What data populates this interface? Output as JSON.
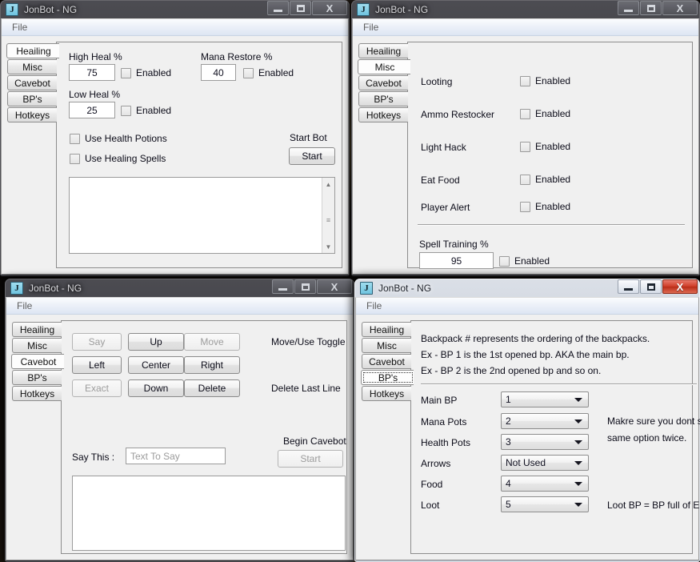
{
  "app": {
    "title": "JonBot - NG",
    "icon": "J"
  },
  "menu": {
    "file": "File"
  },
  "window_buttons": {
    "minimize": "minimize-icon",
    "maximize": "maximize-icon",
    "close": "X"
  },
  "tabs": [
    "Heailing",
    "Misc",
    "Cavebot",
    "BP's",
    "Hotkeys"
  ],
  "windows": {
    "healing": {
      "active_tab": "Heailing",
      "high_heal_label": "High Heal %",
      "high_heal_value": "75",
      "high_heal_enabled_label": "Enabled",
      "low_heal_label": "Low Heal %",
      "low_heal_value": "25",
      "low_heal_enabled_label": "Enabled",
      "mana_restore_label": "Mana Restore %",
      "mana_restore_value": "40",
      "mana_restore_enabled_label": "Enabled",
      "use_health_potions": "Use Health Potions",
      "use_healing_spells": "Use Healing Spells",
      "start_bot_label": "Start Bot",
      "start_button": "Start"
    },
    "misc": {
      "active_tab": "Misc",
      "rows": [
        {
          "label": "Looting",
          "enabled_label": "Enabled"
        },
        {
          "label": "Ammo Restocker",
          "enabled_label": "Enabled"
        },
        {
          "label": "Light Hack",
          "enabled_label": "Enabled"
        },
        {
          "label": "Eat Food",
          "enabled_label": "Enabled"
        },
        {
          "label": "Player Alert",
          "enabled_label": "Enabled"
        }
      ],
      "spell_training_label": "Spell Training %",
      "spell_training_value": "95",
      "spell_training_enabled_label": "Enabled"
    },
    "cavebot": {
      "active_tab": "Cavebot",
      "buttons": [
        {
          "label": "Say",
          "disabled": true
        },
        {
          "label": "Up",
          "disabled": false
        },
        {
          "label": "Move",
          "disabled": true
        },
        {
          "label": "Left",
          "disabled": false
        },
        {
          "label": "Center",
          "disabled": false
        },
        {
          "label": "Right",
          "disabled": false
        },
        {
          "label": "Exact",
          "disabled": true
        },
        {
          "label": "Down",
          "disabled": false
        },
        {
          "label": "Delete",
          "disabled": false
        }
      ],
      "move_use_toggle": "Move/Use Toggle",
      "delete_last_line": "Delete Last Line",
      "begin_cavebot": "Begin Cavebot",
      "start_button": "Start",
      "say_this_label": "Say This :",
      "say_this_placeholder": "Text To Say"
    },
    "bps": {
      "active_tab": "BP's",
      "info_lines": [
        "Backpack # represents the ordering of the backpacks.",
        "Ex - BP 1 is the 1st opened bp. AKA the main bp.",
        "Ex - BP 2 is the 2nd opened bp and so on."
      ],
      "rows": [
        {
          "label": "Main BP",
          "value": "1"
        },
        {
          "label": "Mana Pots",
          "value": "2"
        },
        {
          "label": "Health Pots",
          "value": "3"
        },
        {
          "label": "Arrows",
          "value": "Not Used"
        },
        {
          "label": "Food",
          "value": "4"
        },
        {
          "label": "Loot",
          "value": "5"
        }
      ],
      "note_line1": "Makre sure you dont set the",
      "note_line2": "same option twice.",
      "loot_note": "Loot BP = BP full of Empty BP's"
    }
  }
}
